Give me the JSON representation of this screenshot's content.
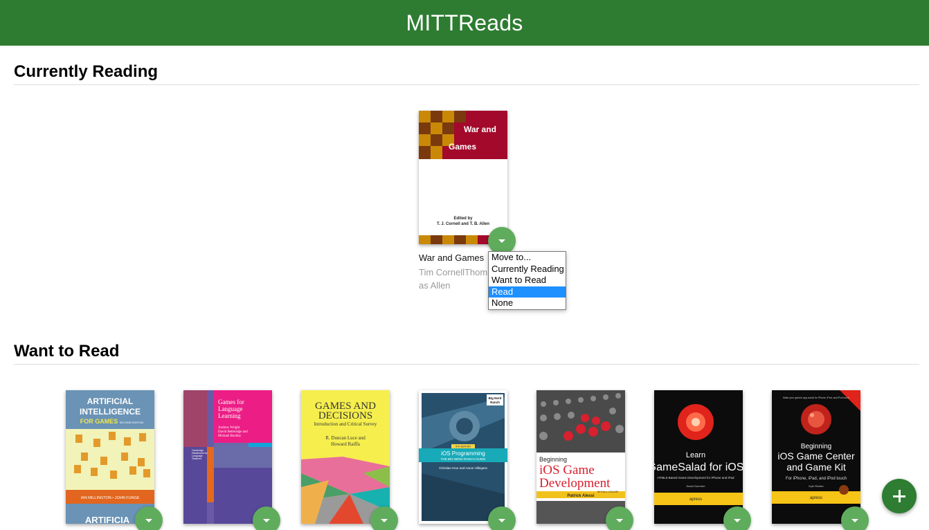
{
  "header": {
    "title": "MITTReads"
  },
  "shelves": [
    {
      "title": "Currently Reading",
      "books": [
        {
          "title": "War and Games",
          "authors": "Tim CornellThomas Allen",
          "cover_title": [
            "War and",
            "Games"
          ],
          "cover_edited": "Edited by",
          "cover_editors": "T. J. Cornell and T. B. Allen"
        }
      ]
    },
    {
      "title": "Want to Read",
      "books": [
        {
          "cover_lines": [
            "ARTIFICIAL",
            "INTELLIGENCE",
            "FOR GAMES",
            "SECOND EDITION",
            "IAN MILLINGTON • JOHN FUNGE",
            "ARTIFICIA"
          ]
        },
        {
          "cover_lines": [
            "Games for",
            "Language",
            "Learning",
            "Andrew Wright",
            "David Betteridge and",
            "Michael Buckby",
            "Cambridge",
            "Handbooks for",
            "Language",
            "Teachers"
          ]
        },
        {
          "cover_lines": [
            "GAMES AND",
            "DECISIONS",
            "Introduction and Critical Survey",
            "R. Duncan Luce and",
            "Howard Raiffa"
          ]
        },
        {
          "cover_lines": [
            "Big Nerd",
            "Ranch",
            "iOS Programming",
            "THE BIG NERD RANCH GUIDE",
            "Christian Keur and Aaron Hillegass",
            "5TH EDITION"
          ]
        },
        {
          "cover_lines": [
            "Beginning",
            "iOS Game",
            "Development",
            "Patrick Alessi",
            "IN FULL COLOR"
          ]
        },
        {
          "cover_lines": [
            "Learn",
            "GameSalad for iOS",
            "HTML5-Based Game Development for iPhone and iPad",
            "David Guerrieri",
            "apress"
          ]
        },
        {
          "cover_lines": [
            "Make your games app-social for iPhone, iPad, and iPod touch",
            "Beginning",
            "iOS Game Center",
            "and Game Kit",
            "For iPhone, iPad, and iPod touch",
            "Kyle Richter",
            "apress"
          ]
        }
      ]
    }
  ],
  "shelf_menu": {
    "options": [
      "Move to...",
      "Currently Reading",
      "Want to Read",
      "Read",
      "None"
    ],
    "selected": "Read"
  },
  "colors": {
    "header": "#2e7c31",
    "changer": "#60ac5d",
    "add": "#2e7d32",
    "selected_option": "#1e90ff"
  }
}
